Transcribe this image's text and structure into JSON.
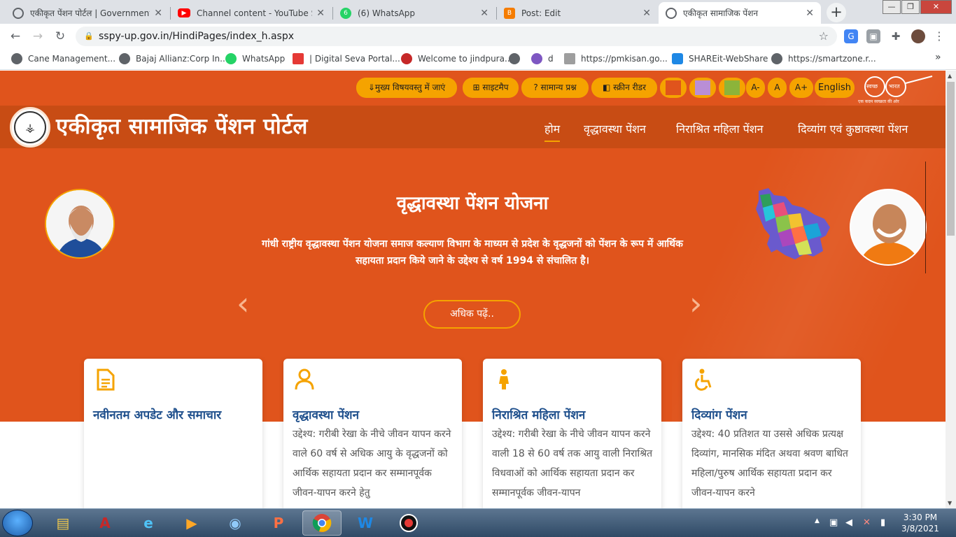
{
  "browser": {
    "tabs": [
      {
        "title": "एकीकृत पेंशन पोर्टल | Government",
        "icon_color": "#5f6368",
        "active": false
      },
      {
        "title": "Channel content - YouTube Studio",
        "icon_color": "#ff0000",
        "active": false
      },
      {
        "title": "(6) WhatsApp",
        "icon_color": "#25d366",
        "active": false
      },
      {
        "title": "Post: Edit",
        "icon_color": "#f57c00",
        "active": false
      },
      {
        "title": "एकीकृत सामाजिक पेंशन",
        "icon_color": "#5f6368",
        "active": true
      }
    ],
    "new_tab": "+",
    "window_buttons": [
      "—",
      "❐",
      "✕"
    ],
    "url": "sspy-up.gov.in/HindiPages/index_h.aspx",
    "bookmarks": [
      {
        "label": "Cane Management...",
        "icon_color": "#5f6368"
      },
      {
        "label": "Bajaj Allianz:Corp In...",
        "icon_color": "#5f6368"
      },
      {
        "label": "WhatsApp",
        "icon_color": "#25d366"
      },
      {
        "label": "| Digital Seva Portal...",
        "icon_color": "#e53935"
      },
      {
        "label": "Welcome to jindpura...",
        "icon_color": "#c62828"
      },
      {
        "label": "",
        "icon_color": "#5f6368"
      },
      {
        "label": "d",
        "icon_color": "#7e57c2"
      },
      {
        "label": "https://pmkisan.go...",
        "icon_color": "#9e9e9e"
      },
      {
        "label": "SHAREit-WebShare",
        "icon_color": "#1e88e5"
      },
      {
        "label": "https://smartzone.r...",
        "icon_color": "#5f6368"
      }
    ]
  },
  "site": {
    "utility": {
      "skip": "मुख्य विषयवस्तु में जाएं",
      "sitemap": "साइटमैप",
      "faq": "सामान्य प्रश्न",
      "reader": "स्क्रीन रीडर",
      "theme_colors": [
        "#e0541c",
        "#b98ed6",
        "#8cb43a"
      ],
      "font_minus": "A-",
      "font_normal": "A",
      "font_plus": "A+",
      "language": "English"
    },
    "swachh": {
      "line1": "स्वच्छ",
      "line2": "भारत",
      "tagline": "एक कदम स्वच्छता की ओर"
    },
    "title": "एकीकृत सामाजिक पेंशन पोर्टल",
    "nav": [
      "होम",
      "वृद्धावस्था पेंशन",
      "निराश्रित महिला पेंशन",
      "दिव्यांग एवं कुष्ठावस्था पेंशन"
    ],
    "slider": {
      "title": "वृद्धावस्था पेंशन योजना",
      "text": "गांधी राष्ट्रीय वृद्धावस्था पेंशन योजना समाज कल्याण विभाग के माध्यम से प्रदेश के वृद्धजनों को पेंशन के रूप में आर्थिक सहायता प्रदान किये जाने के उद्देश्य से वर्ष 1994 से संचालित है।",
      "button": "अधिक पढ़ें..",
      "prev": "‹",
      "next": "›"
    },
    "cards": [
      {
        "icon": "document-icon",
        "title": "नवीनतम अपडेट और समाचार",
        "text": ""
      },
      {
        "icon": "person-icon",
        "title": "वृद्धावस्था पेंशन",
        "text": "उद्देश्य: गरीबी रेखा के नीचे जीवन यापन करने वाले 60 वर्ष से अधिक आयु के वृद्धजनों को आर्थिक सहायता प्रदान कर सम्मानपूर्वक जीवन-यापन करने हेतु"
      },
      {
        "icon": "woman-icon",
        "title": "निराश्रित महिला पेंशन",
        "text": "उद्देश्य: गरीबी रेखा के नीचे जीवन यापन करने वाली 18 से 60 वर्ष तक आयु वाली निराश्रित विधवाओं को आर्थिक सहायता प्रदान कर सम्मानपूर्वक जीवन-यापन"
      },
      {
        "icon": "wheelchair-icon",
        "title": "दिव्यांग पेंशन",
        "text": "उद्देश्य: 40 प्रतिशत या उससे अधिक प्रत्यक्ष दिव्यांग, मानसिक मंदित अथवा श्रवण बाधित महिला/पुरुष आर्थिक सहायता प्रदान कर जीवन-यापन करने"
      }
    ],
    "accent": "#e0541c",
    "gold": "#f5a300"
  },
  "taskbar": {
    "apps": [
      "explorer",
      "acrobat",
      "internet-explorer",
      "media-player",
      "photo-viewer",
      "powerpoint",
      "chrome",
      "word",
      "recorder"
    ],
    "time": "3:30 PM",
    "date": "3/8/2021"
  }
}
